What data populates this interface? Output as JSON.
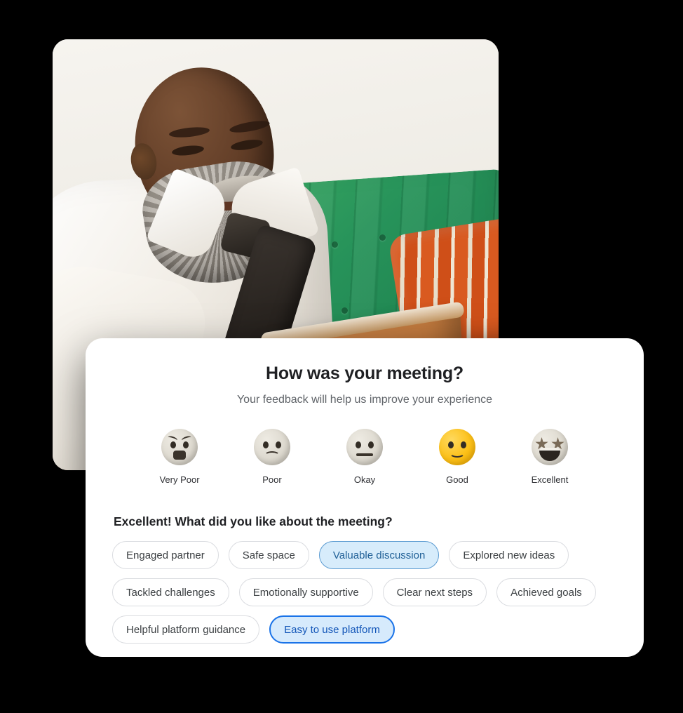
{
  "photo": {
    "alt": "Man in white shirt and black tie sitting on a green velvet couch using a tablet",
    "subject": "seated man with gray beard",
    "couch_color": "#27935a",
    "pillow_color": "#d95a20",
    "device_color": "#bd7438",
    "wall_color": "#f3f1ec"
  },
  "feedback": {
    "title": "How was your meeting?",
    "subtitle": "Your feedback will help us improve your experience",
    "ratings": [
      {
        "label": "Very Poor",
        "face": "fearful-face-icon",
        "selected": false
      },
      {
        "label": "Poor",
        "face": "frowning-face-icon",
        "selected": false
      },
      {
        "label": "Okay",
        "face": "neutral-face-icon",
        "selected": false
      },
      {
        "label": "Good",
        "face": "slightly-smiling-face-icon",
        "selected": true
      },
      {
        "label": "Excellent",
        "face": "star-struck-face-icon",
        "selected": false
      }
    ],
    "selected_rating": "Good",
    "chips_heading": "Excellent! What did you like about the meeting?",
    "chips": [
      {
        "label": "Engaged partner",
        "state": "unselected"
      },
      {
        "label": "Safe space",
        "state": "unselected"
      },
      {
        "label": "Valuable discussion",
        "state": "selected-soft"
      },
      {
        "label": "Explored new ideas",
        "state": "unselected"
      },
      {
        "label": "Tackled challenges",
        "state": "unselected"
      },
      {
        "label": "Emotionally supportive",
        "state": "unselected"
      },
      {
        "label": "Clear next steps",
        "state": "unselected"
      },
      {
        "label": "Achieved goals",
        "state": "unselected"
      },
      {
        "label": "Helpful platform guidance",
        "state": "unselected"
      },
      {
        "label": "Easy to use platform",
        "state": "selected-strong"
      }
    ],
    "colors": {
      "accent_blue": "#1a73e8",
      "chip_selected_fill": "#d6eafc",
      "chip_border": "#dadce0",
      "title_color": "#1f2023",
      "subtitle_color": "#5f6368",
      "selected_face_yellow": "#fcc017",
      "background": "#000000"
    }
  }
}
